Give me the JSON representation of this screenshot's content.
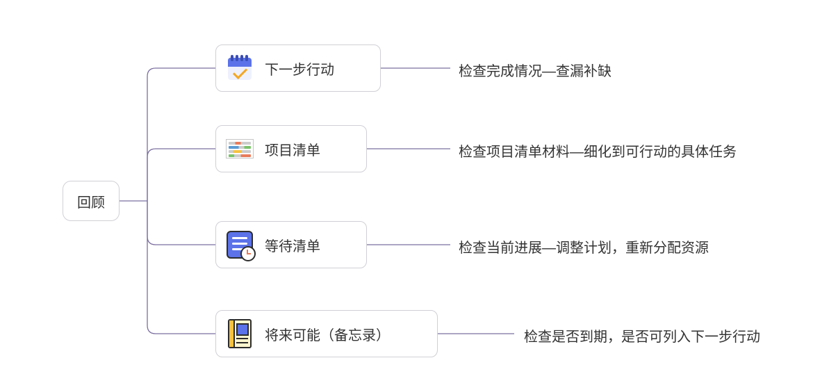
{
  "root": {
    "label": "回顾"
  },
  "branches": [
    {
      "icon": "calendar-check-icon",
      "label": "下一步行动",
      "leaf": "检查完成情况—查漏补缺"
    },
    {
      "icon": "spreadsheet-icon",
      "label": "项目清单",
      "leaf": "检查项目清单材料—细化到可行动的具体任务"
    },
    {
      "icon": "waitlist-clock-icon",
      "label": "等待清单",
      "leaf": "检查当前进展—调整计划，重新分配资源"
    },
    {
      "icon": "notebook-icon",
      "label": "将来可能（备忘录）",
      "leaf": "检查是否到期，是否可列入下一步行动"
    }
  ],
  "colors": {
    "connector": "#7b6fa0",
    "border": "#d0d0d6"
  }
}
